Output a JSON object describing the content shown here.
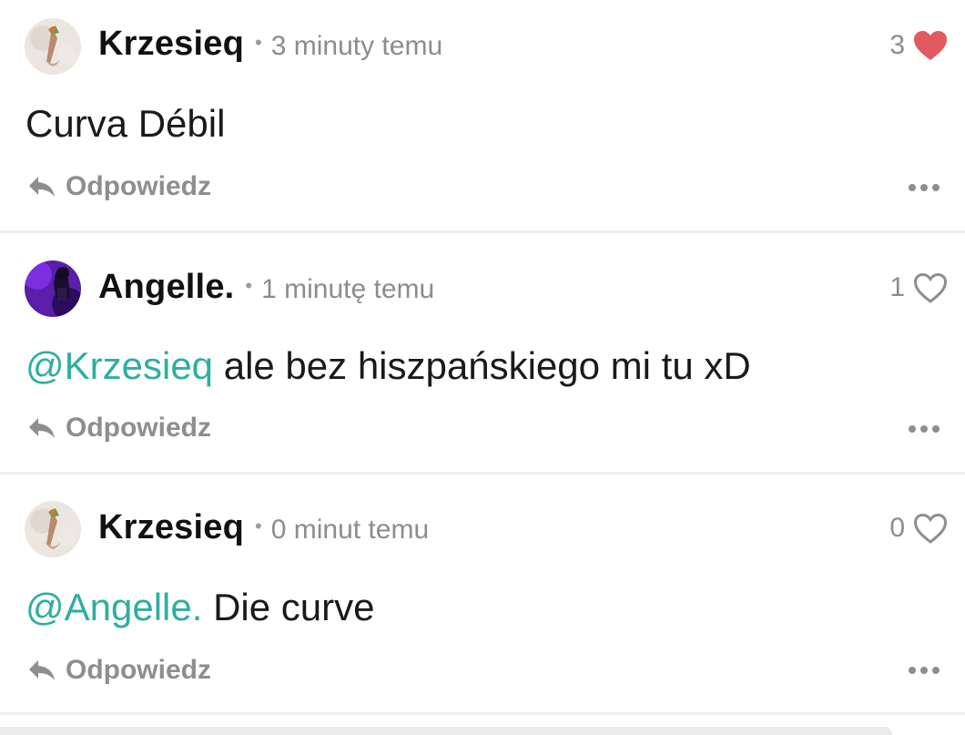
{
  "comments": [
    {
      "username": "Krzesieq",
      "separator": "•",
      "time": "3 minuty temu",
      "like_count": "3",
      "liked": true,
      "mention": "",
      "text": "Curva Débil",
      "reply_label": "Odpowiedz",
      "avatar_icon": "profile-photo-avatar",
      "more_icon": "more-options-icon"
    },
    {
      "username": "Angelle.",
      "separator": "•",
      "time": "1 minutę temu",
      "like_count": "1",
      "liked": false,
      "mention": "@Krzesieq",
      "text": " ale bez hiszpańskiego mi tu xD",
      "reply_label": "Odpowiedz",
      "avatar_icon": "profile-photo-avatar",
      "more_icon": "more-options-icon"
    },
    {
      "username": "Krzesieq",
      "separator": "•",
      "time": "0 minut temu",
      "like_count": "0",
      "liked": false,
      "mention": "@Angelle.",
      "text": " Die curve",
      "reply_label": "Odpowiedz",
      "avatar_icon": "profile-photo-avatar",
      "more_icon": "more-options-icon"
    }
  ],
  "colors": {
    "mention": "#2eaf9f",
    "heart_filled": "#e05a60",
    "muted_text": "#8c8c8c",
    "divider": "#eeeeee"
  }
}
